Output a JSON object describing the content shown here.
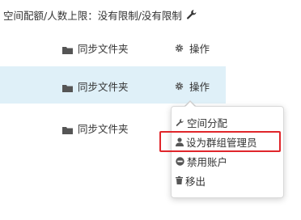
{
  "quota": {
    "text": "空间配额/人数上限：没有限制/没有限制",
    "edit_icon": "wrench-icon"
  },
  "rows": [
    {
      "name": "同步文件夹",
      "action": "操作",
      "icon": "folder-icon"
    },
    {
      "name": "同步文件夹",
      "action": "操作",
      "icon": "folder-icon",
      "highlighted": true
    },
    {
      "name": "同步文件夹",
      "icon": "folder-icon"
    }
  ],
  "action_icon": "gear-icon",
  "menu": {
    "items": [
      {
        "label": "空间分配",
        "icon": "wrench-icon"
      },
      {
        "label": "设为群组管理员",
        "icon": "user-icon",
        "highlighted": true
      },
      {
        "label": "禁用账户",
        "icon": "minus-circle-icon"
      },
      {
        "label": "移出",
        "icon": "trash-icon"
      }
    ]
  },
  "colors": {
    "row_highlight": "#dff0f8",
    "annotation_box": "#e0262b",
    "icon": "#555555"
  }
}
